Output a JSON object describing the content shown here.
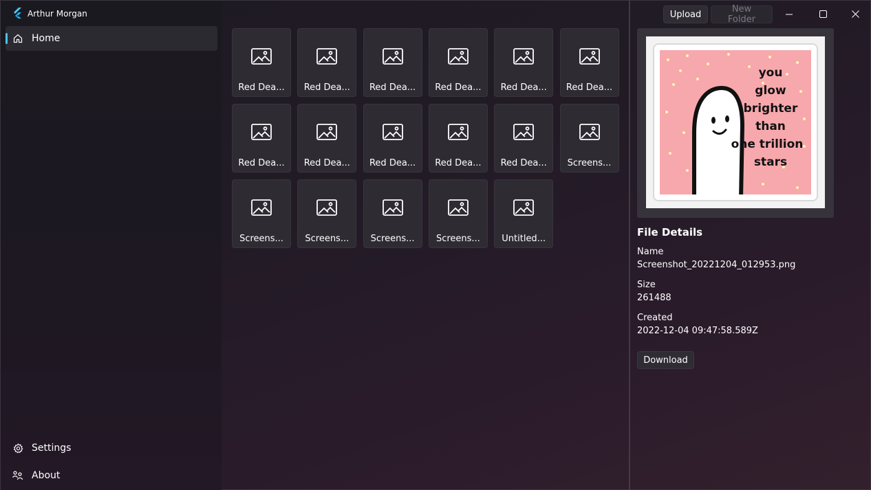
{
  "app": {
    "title": "Arthur Morgan",
    "accent": "#4cc2ff"
  },
  "sidebar": {
    "items": [
      {
        "label": "Home",
        "icon": "home-icon",
        "selected": true
      },
      {
        "label": "Settings",
        "icon": "gear-icon"
      },
      {
        "label": "About",
        "icon": "people-icon"
      }
    ]
  },
  "files": [
    {
      "label": "Red Dea..."
    },
    {
      "label": "Red Dea..."
    },
    {
      "label": "Red Dea..."
    },
    {
      "label": "Red Dea..."
    },
    {
      "label": "Red Dea..."
    },
    {
      "label": "Red Dea..."
    },
    {
      "label": "Red Dea..."
    },
    {
      "label": "Red Dea..."
    },
    {
      "label": "Red Dea..."
    },
    {
      "label": "Red Dea..."
    },
    {
      "label": "Red Dea..."
    },
    {
      "label": "Screens..."
    },
    {
      "label": "Screens..."
    },
    {
      "label": "Screens..."
    },
    {
      "label": "Screens..."
    },
    {
      "label": "Screens..."
    },
    {
      "label": "Untitled..."
    }
  ],
  "toolbar": {
    "upload_label": "Upload",
    "new_folder_label": "New Folder"
  },
  "preview": {
    "lines": [
      "you",
      "glow",
      "brighter",
      "than",
      "one trillion",
      "stars"
    ]
  },
  "details": {
    "title": "File Details",
    "name_label": "Name",
    "name_value": "Screenshot_20221204_012953.png",
    "size_label": "Size",
    "size_value": "261488",
    "created_label": "Created",
    "created_value": "2022-12-04 09:47:58.589Z",
    "download_label": "Download"
  }
}
